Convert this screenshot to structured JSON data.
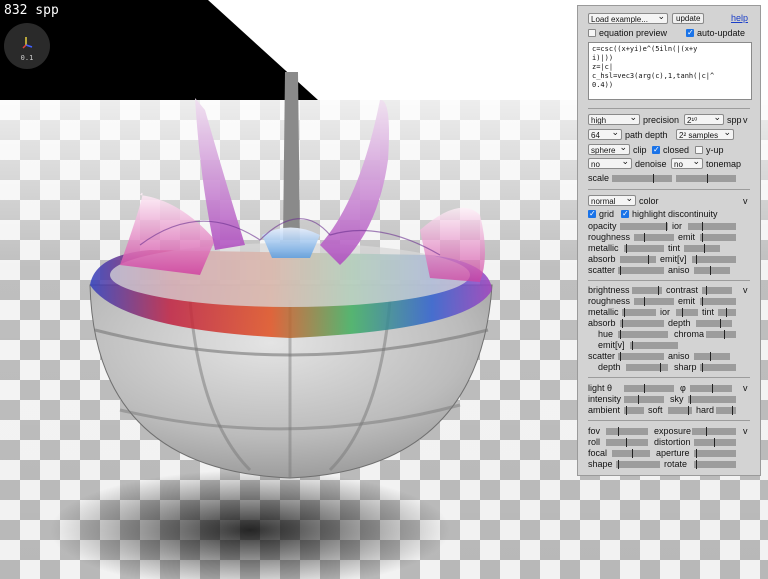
{
  "status": {
    "spp_counter": "832 spp",
    "axes_scale": "0.1"
  },
  "editor": {
    "load_example": "Load example...",
    "update": "update",
    "help": "help",
    "equation_preview": "equation preview",
    "equation_preview_checked": false,
    "auto_update": "auto-update",
    "auto_update_checked": true,
    "code": "c=csc((x+yi)e^(5iln(|(x+y\ni)|))\nz=|c|\nc_hsl=vec3(arg(c),1,tanh(|c|^\n0.4))"
  },
  "render": {
    "precision_value": "high",
    "precision_label": "precision",
    "spp_value": "2¹⁰",
    "spp_label": "spp",
    "path_depth_value": "64",
    "path_depth_label": "path depth",
    "samples_value": "2² samples",
    "clip_value": "sphere",
    "clip_label": "clip",
    "closed_label": "closed",
    "closed_checked": true,
    "y_up_label": "y-up",
    "y_up_checked": false,
    "denoise_value": "no",
    "denoise_label": "denoise",
    "tonemap_value": "no",
    "tonemap_label": "tonemap",
    "scale_label": "scale",
    "scale_level": 0.68,
    "scale2_level": 0.52
  },
  "material": {
    "color_mode": "normal",
    "color_label": "color",
    "grid_label": "grid",
    "grid_checked": true,
    "highlight_label": "highlight discontinuity",
    "highlight_checked": true,
    "opacity": "opacity",
    "ior": "ior",
    "roughness": "roughness",
    "emit": "emit",
    "metallic": "metallic",
    "tint": "tint",
    "absorb": "absorb",
    "emit_v": "emit[v]",
    "scatter": "scatter",
    "aniso": "aniso"
  },
  "base": {
    "brightness": "brightness",
    "contrast": "contrast",
    "roughness": "roughness",
    "emit": "emit",
    "metallic": "metallic",
    "ior": "ior",
    "tint": "tint",
    "absorb": "absorb",
    "depth": "depth",
    "hue": "hue",
    "chroma": "chroma",
    "emit_v": "emit[v]",
    "scatter": "scatter",
    "aniso": "aniso",
    "depth2": "depth",
    "sharp": "sharp"
  },
  "light": {
    "theta": "light θ",
    "phi": "φ",
    "intensity": "intensity",
    "sky": "sky",
    "ambient": "ambient",
    "soft": "soft",
    "hard": "hard"
  },
  "camera": {
    "fov": "fov",
    "exposure": "exposure",
    "roll": "roll",
    "distortion": "distortion",
    "focal": "focal",
    "aperture": "aperture",
    "shape": "shape",
    "rotate": "rotate"
  },
  "colors": {
    "panel_bg": "#d3d3d3",
    "accent": "#1a73e8",
    "sky_black": "#000000"
  }
}
